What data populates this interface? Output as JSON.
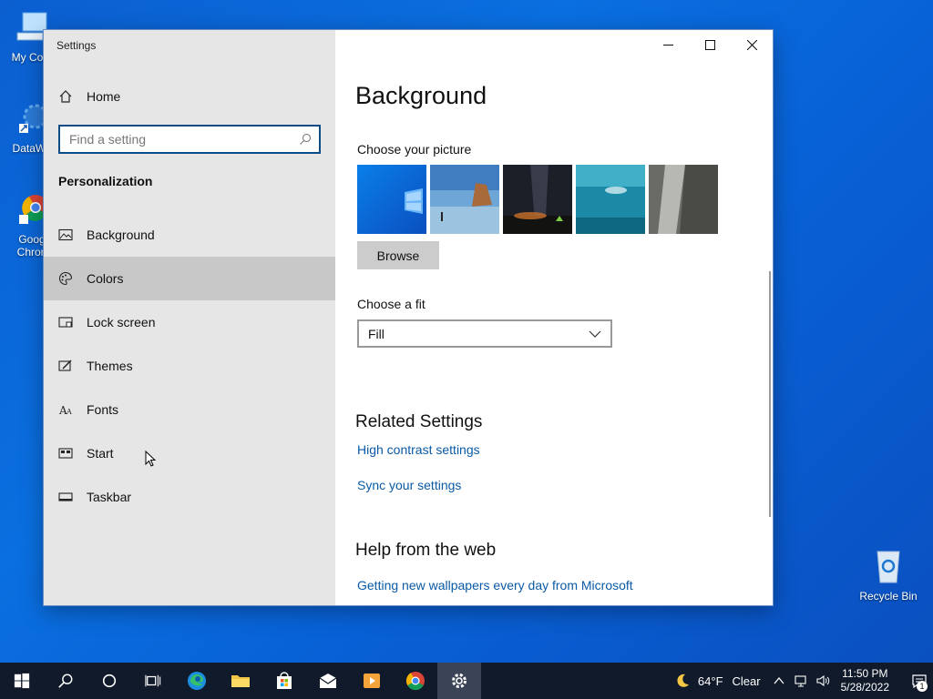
{
  "desktop": {
    "icons": [
      {
        "label": "My Com"
      },
      {
        "label": "DataWa"
      },
      {
        "label": "Goog Chron"
      },
      {
        "label": "Recycle Bin"
      }
    ]
  },
  "window": {
    "title": "Settings",
    "sidebar": {
      "home_label": "Home",
      "search_placeholder": "Find a setting",
      "section_title": "Personalization",
      "items": [
        {
          "label": "Background",
          "icon": "picture-icon"
        },
        {
          "label": "Colors",
          "icon": "palette-icon"
        },
        {
          "label": "Lock screen",
          "icon": "lock-screen-icon"
        },
        {
          "label": "Themes",
          "icon": "themes-icon"
        },
        {
          "label": "Fonts",
          "icon": "fonts-icon"
        },
        {
          "label": "Start",
          "icon": "start-icon"
        },
        {
          "label": "Taskbar",
          "icon": "taskbar-icon"
        }
      ]
    },
    "content": {
      "title": "Background",
      "choose_picture": "Choose your picture",
      "browse_label": "Browse",
      "choose_fit": "Choose a fit",
      "fit_value": "Fill",
      "related_title": "Related Settings",
      "related_links": [
        "High contrast settings",
        "Sync your settings"
      ],
      "help_title": "Help from the web",
      "help_links": [
        "Getting new wallpapers every day from Microsoft"
      ]
    }
  },
  "taskbar": {
    "weather_temp": "64°F",
    "weather_cond": "Clear",
    "time": "11:50 PM",
    "date": "5/28/2022",
    "notification_count": "1"
  },
  "colors": {
    "accent": "#0a4c86",
    "link": "#0a5aa6",
    "sidebar_bg": "#e6e6e6",
    "taskbar_bg": "#101a2a"
  }
}
